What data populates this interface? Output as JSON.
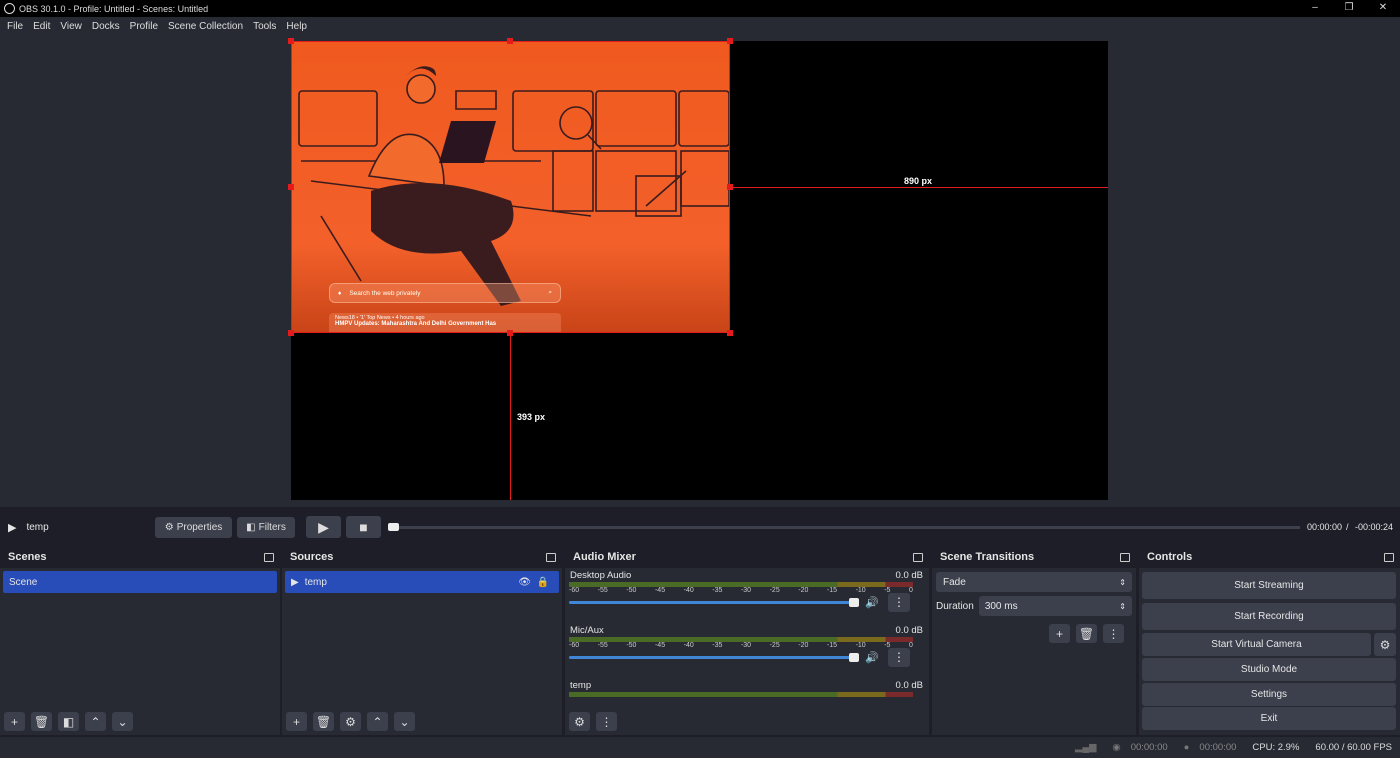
{
  "window": {
    "title": "OBS 30.1.0 - Profile: Untitled - Scenes: Untitled",
    "minimize": "–",
    "restore": "❐",
    "close": "✕"
  },
  "menu": [
    "File",
    "Edit",
    "View",
    "Docks",
    "Profile",
    "Scene Collection",
    "Tools",
    "Help"
  ],
  "preview": {
    "width_label": "890 px",
    "height_label": "393 px",
    "search_placeholder": "Search the web privately",
    "news_source": "News18 • '1' Top News • 4 hours ago",
    "news_headline": "HMPV Updates: Maharashtra And Delhi Government Has"
  },
  "media": {
    "source_name": "temp",
    "properties_label": "Properties",
    "filters_label": "Filters",
    "time_current": "00:00:00",
    "time_sep": "/",
    "time_remaining": "-00:00:24",
    "progress": 0.0
  },
  "scenes": {
    "title": "Scenes",
    "items": [
      "Scene"
    ]
  },
  "sources": {
    "title": "Sources",
    "items": [
      "temp"
    ]
  },
  "mixer": {
    "title": "Audio Mixer",
    "ticks": [
      "-60",
      "-55",
      "-50",
      "-45",
      "-40",
      "-35",
      "-30",
      "-25",
      "-20",
      "-15",
      "-10",
      "-5",
      "0"
    ],
    "channels": [
      {
        "name": "Desktop Audio",
        "db": "0.0 dB",
        "volume": 1.0
      },
      {
        "name": "Mic/Aux",
        "db": "0.0 dB",
        "volume": 1.0
      },
      {
        "name": "temp",
        "db": "0.0 dB",
        "volume": 1.0
      }
    ]
  },
  "transitions": {
    "title": "Scene Transitions",
    "selected": "Fade",
    "duration_label": "Duration",
    "duration_value": "300 ms"
  },
  "controls": {
    "title": "Controls",
    "start_streaming": "Start Streaming",
    "start_recording": "Start Recording",
    "start_virtual_camera": "Start Virtual Camera",
    "studio_mode": "Studio Mode",
    "settings": "Settings",
    "exit": "Exit"
  },
  "status": {
    "stream_time": "00:00:00",
    "record_time": "00:00:00",
    "cpu": "CPU: 2.9%",
    "fps": "60.00 / 60.00 FPS"
  }
}
